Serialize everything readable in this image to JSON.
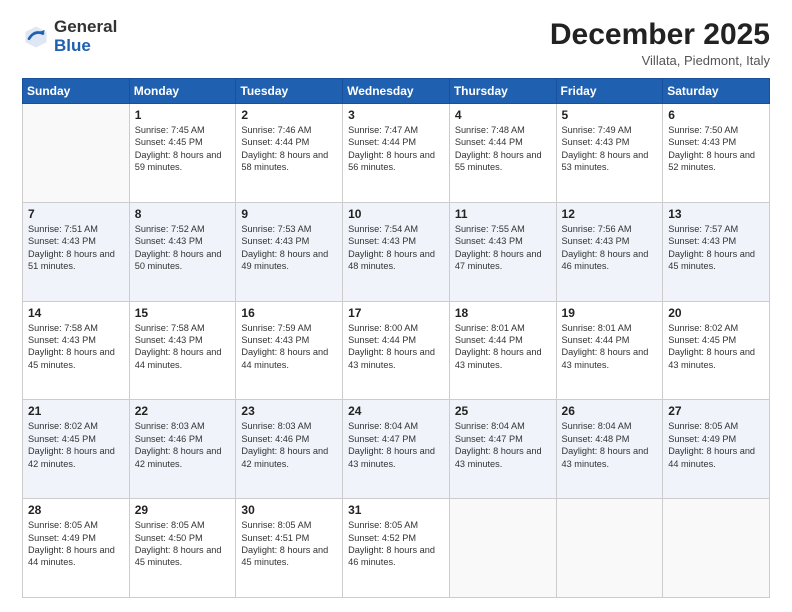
{
  "logo": {
    "general": "General",
    "blue": "Blue"
  },
  "header": {
    "month": "December 2025",
    "location": "Villata, Piedmont, Italy"
  },
  "days_of_week": [
    "Sunday",
    "Monday",
    "Tuesday",
    "Wednesday",
    "Thursday",
    "Friday",
    "Saturday"
  ],
  "weeks": [
    [
      {
        "day": "",
        "sunrise": "",
        "sunset": "",
        "daylight": ""
      },
      {
        "day": "1",
        "sunrise": "Sunrise: 7:45 AM",
        "sunset": "Sunset: 4:45 PM",
        "daylight": "Daylight: 8 hours and 59 minutes."
      },
      {
        "day": "2",
        "sunrise": "Sunrise: 7:46 AM",
        "sunset": "Sunset: 4:44 PM",
        "daylight": "Daylight: 8 hours and 58 minutes."
      },
      {
        "day": "3",
        "sunrise": "Sunrise: 7:47 AM",
        "sunset": "Sunset: 4:44 PM",
        "daylight": "Daylight: 8 hours and 56 minutes."
      },
      {
        "day": "4",
        "sunrise": "Sunrise: 7:48 AM",
        "sunset": "Sunset: 4:44 PM",
        "daylight": "Daylight: 8 hours and 55 minutes."
      },
      {
        "day": "5",
        "sunrise": "Sunrise: 7:49 AM",
        "sunset": "Sunset: 4:43 PM",
        "daylight": "Daylight: 8 hours and 53 minutes."
      },
      {
        "day": "6",
        "sunrise": "Sunrise: 7:50 AM",
        "sunset": "Sunset: 4:43 PM",
        "daylight": "Daylight: 8 hours and 52 minutes."
      }
    ],
    [
      {
        "day": "7",
        "sunrise": "Sunrise: 7:51 AM",
        "sunset": "Sunset: 4:43 PM",
        "daylight": "Daylight: 8 hours and 51 minutes."
      },
      {
        "day": "8",
        "sunrise": "Sunrise: 7:52 AM",
        "sunset": "Sunset: 4:43 PM",
        "daylight": "Daylight: 8 hours and 50 minutes."
      },
      {
        "day": "9",
        "sunrise": "Sunrise: 7:53 AM",
        "sunset": "Sunset: 4:43 PM",
        "daylight": "Daylight: 8 hours and 49 minutes."
      },
      {
        "day": "10",
        "sunrise": "Sunrise: 7:54 AM",
        "sunset": "Sunset: 4:43 PM",
        "daylight": "Daylight: 8 hours and 48 minutes."
      },
      {
        "day": "11",
        "sunrise": "Sunrise: 7:55 AM",
        "sunset": "Sunset: 4:43 PM",
        "daylight": "Daylight: 8 hours and 47 minutes."
      },
      {
        "day": "12",
        "sunrise": "Sunrise: 7:56 AM",
        "sunset": "Sunset: 4:43 PM",
        "daylight": "Daylight: 8 hours and 46 minutes."
      },
      {
        "day": "13",
        "sunrise": "Sunrise: 7:57 AM",
        "sunset": "Sunset: 4:43 PM",
        "daylight": "Daylight: 8 hours and 45 minutes."
      }
    ],
    [
      {
        "day": "14",
        "sunrise": "Sunrise: 7:58 AM",
        "sunset": "Sunset: 4:43 PM",
        "daylight": "Daylight: 8 hours and 45 minutes."
      },
      {
        "day": "15",
        "sunrise": "Sunrise: 7:58 AM",
        "sunset": "Sunset: 4:43 PM",
        "daylight": "Daylight: 8 hours and 44 minutes."
      },
      {
        "day": "16",
        "sunrise": "Sunrise: 7:59 AM",
        "sunset": "Sunset: 4:43 PM",
        "daylight": "Daylight: 8 hours and 44 minutes."
      },
      {
        "day": "17",
        "sunrise": "Sunrise: 8:00 AM",
        "sunset": "Sunset: 4:44 PM",
        "daylight": "Daylight: 8 hours and 43 minutes."
      },
      {
        "day": "18",
        "sunrise": "Sunrise: 8:01 AM",
        "sunset": "Sunset: 4:44 PM",
        "daylight": "Daylight: 8 hours and 43 minutes."
      },
      {
        "day": "19",
        "sunrise": "Sunrise: 8:01 AM",
        "sunset": "Sunset: 4:44 PM",
        "daylight": "Daylight: 8 hours and 43 minutes."
      },
      {
        "day": "20",
        "sunrise": "Sunrise: 8:02 AM",
        "sunset": "Sunset: 4:45 PM",
        "daylight": "Daylight: 8 hours and 43 minutes."
      }
    ],
    [
      {
        "day": "21",
        "sunrise": "Sunrise: 8:02 AM",
        "sunset": "Sunset: 4:45 PM",
        "daylight": "Daylight: 8 hours and 42 minutes."
      },
      {
        "day": "22",
        "sunrise": "Sunrise: 8:03 AM",
        "sunset": "Sunset: 4:46 PM",
        "daylight": "Daylight: 8 hours and 42 minutes."
      },
      {
        "day": "23",
        "sunrise": "Sunrise: 8:03 AM",
        "sunset": "Sunset: 4:46 PM",
        "daylight": "Daylight: 8 hours and 42 minutes."
      },
      {
        "day": "24",
        "sunrise": "Sunrise: 8:04 AM",
        "sunset": "Sunset: 4:47 PM",
        "daylight": "Daylight: 8 hours and 43 minutes."
      },
      {
        "day": "25",
        "sunrise": "Sunrise: 8:04 AM",
        "sunset": "Sunset: 4:47 PM",
        "daylight": "Daylight: 8 hours and 43 minutes."
      },
      {
        "day": "26",
        "sunrise": "Sunrise: 8:04 AM",
        "sunset": "Sunset: 4:48 PM",
        "daylight": "Daylight: 8 hours and 43 minutes."
      },
      {
        "day": "27",
        "sunrise": "Sunrise: 8:05 AM",
        "sunset": "Sunset: 4:49 PM",
        "daylight": "Daylight: 8 hours and 44 minutes."
      }
    ],
    [
      {
        "day": "28",
        "sunrise": "Sunrise: 8:05 AM",
        "sunset": "Sunset: 4:49 PM",
        "daylight": "Daylight: 8 hours and 44 minutes."
      },
      {
        "day": "29",
        "sunrise": "Sunrise: 8:05 AM",
        "sunset": "Sunset: 4:50 PM",
        "daylight": "Daylight: 8 hours and 45 minutes."
      },
      {
        "day": "30",
        "sunrise": "Sunrise: 8:05 AM",
        "sunset": "Sunset: 4:51 PM",
        "daylight": "Daylight: 8 hours and 45 minutes."
      },
      {
        "day": "31",
        "sunrise": "Sunrise: 8:05 AM",
        "sunset": "Sunset: 4:52 PM",
        "daylight": "Daylight: 8 hours and 46 minutes."
      },
      {
        "day": "",
        "sunrise": "",
        "sunset": "",
        "daylight": ""
      },
      {
        "day": "",
        "sunrise": "",
        "sunset": "",
        "daylight": ""
      },
      {
        "day": "",
        "sunrise": "",
        "sunset": "",
        "daylight": ""
      }
    ]
  ]
}
